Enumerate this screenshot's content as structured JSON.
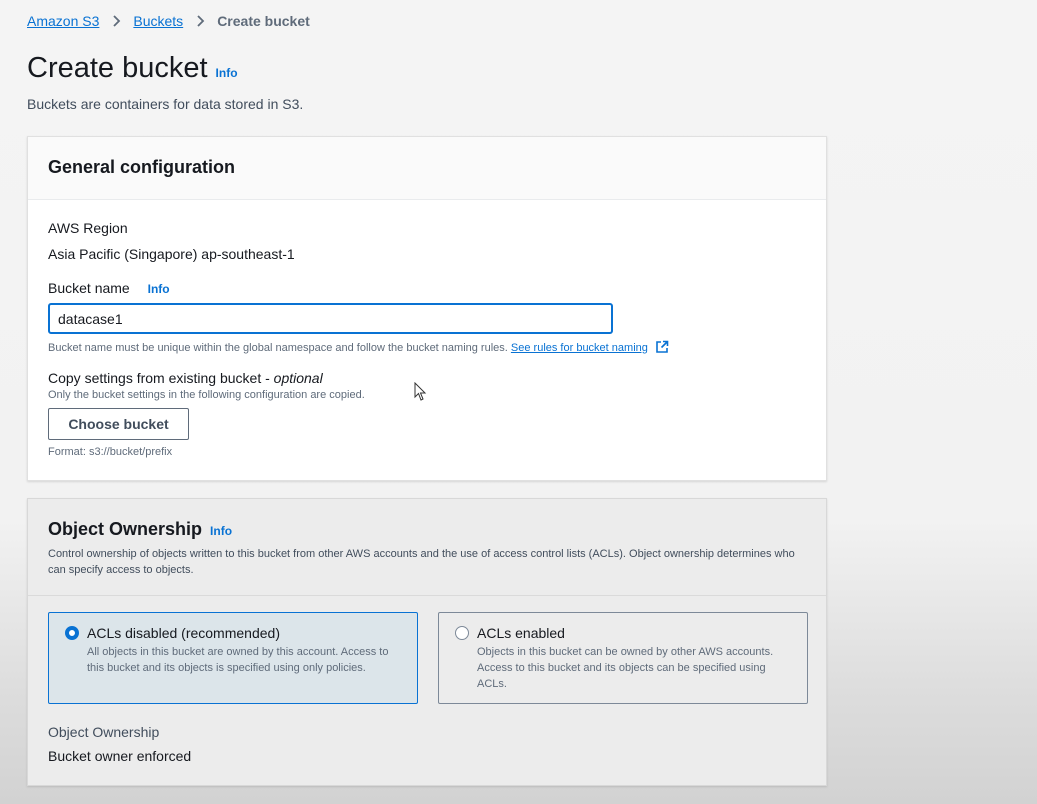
{
  "breadcrumb": {
    "root": "Amazon S3",
    "buckets": "Buckets",
    "current": "Create bucket"
  },
  "header": {
    "title": "Create bucket",
    "info": "Info",
    "description": "Buckets are containers for data stored in S3."
  },
  "general": {
    "title": "General configuration",
    "region_label": "AWS Region",
    "region_value": "Asia Pacific (Singapore) ap-southeast-1",
    "bucket_name_label": "Bucket name",
    "bucket_name_info": "Info",
    "bucket_name_value": "datacase1",
    "bucket_name_hint": "Bucket name must be unique within the global namespace and follow the bucket naming rules.",
    "rules_link": "See rules for bucket naming",
    "copy_label": "Copy settings from existing bucket - ",
    "copy_optional": "optional",
    "copy_hint": "Only the bucket settings in the following configuration are copied.",
    "choose_button": "Choose bucket",
    "format_hint": "Format: s3://bucket/prefix"
  },
  "ownership": {
    "title": "Object Ownership",
    "info": "Info",
    "description": "Control ownership of objects written to this bucket from other AWS accounts and the use of access control lists (ACLs). Object ownership determines who can specify access to objects.",
    "options": [
      {
        "label": "ACLs disabled (recommended)",
        "description": "All objects in this bucket are owned by this account. Access to this bucket and its objects is specified using only policies.",
        "selected": true
      },
      {
        "label": "ACLs enabled",
        "description": "Objects in this bucket can be owned by other AWS accounts. Access to this bucket and its objects can be specified using ACLs.",
        "selected": false
      }
    ],
    "ownership_label": "Object Ownership",
    "ownership_value": "Bucket owner enforced"
  },
  "colors": {
    "accent": "#0972d3",
    "text": "#16191f",
    "muted": "#5f6b7a"
  }
}
